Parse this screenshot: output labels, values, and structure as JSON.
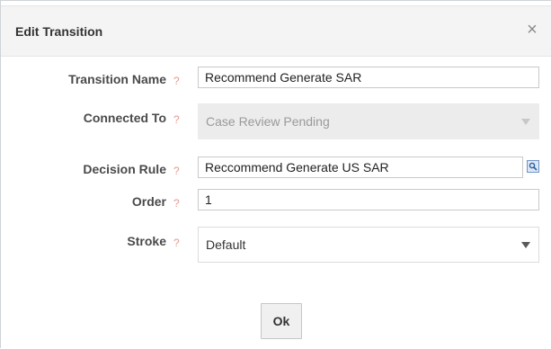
{
  "dialog": {
    "title": "Edit Transition",
    "close_icon": "×"
  },
  "form": {
    "help_mark": "?",
    "transition_name": {
      "label": "Transition Name",
      "value": "Recommend Generate SAR"
    },
    "connected_to": {
      "label": "Connected To",
      "value": "Case Review Pending",
      "disabled": true
    },
    "decision_rule": {
      "label": "Decision Rule",
      "value": "Reccommend Generate US SAR",
      "lookup_icon": "search-icon"
    },
    "order": {
      "label": "Order",
      "value": "1"
    },
    "stroke": {
      "label": "Stroke",
      "value": "Default"
    }
  },
  "actions": {
    "ok_label": "Ok"
  },
  "colors": {
    "help_mark": "#e49b8e",
    "header_bg": "#f4f4f4",
    "disabled_bg": "#ececec"
  }
}
